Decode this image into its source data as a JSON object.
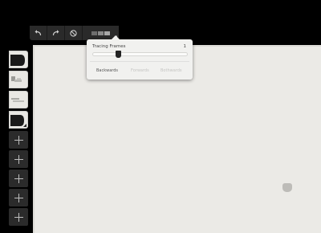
{
  "toolbar": {
    "undo_icon": "undo-icon",
    "redo_icon": "redo-icon",
    "clear_icon": "clear-icon",
    "onion_icon": "onion-skin-icon",
    "onion_swatches": [
      "#6e6e6e",
      "#8a8a8a",
      "#a8a8a8"
    ]
  },
  "tracing": {
    "title": "Tracing Frames",
    "count": "1",
    "level": 0.25,
    "options": [
      {
        "label": "Backwards",
        "active": true
      },
      {
        "label": "Forwards",
        "active": false
      },
      {
        "label": "Bothwards",
        "active": false
      }
    ]
  },
  "frames": {
    "thumbnails": 4,
    "empty_slots": 5,
    "add_icon": "plus-icon"
  },
  "colors": {
    "background": "#000000",
    "canvas": "#ebeae6",
    "panel": "#2b2b2b"
  }
}
